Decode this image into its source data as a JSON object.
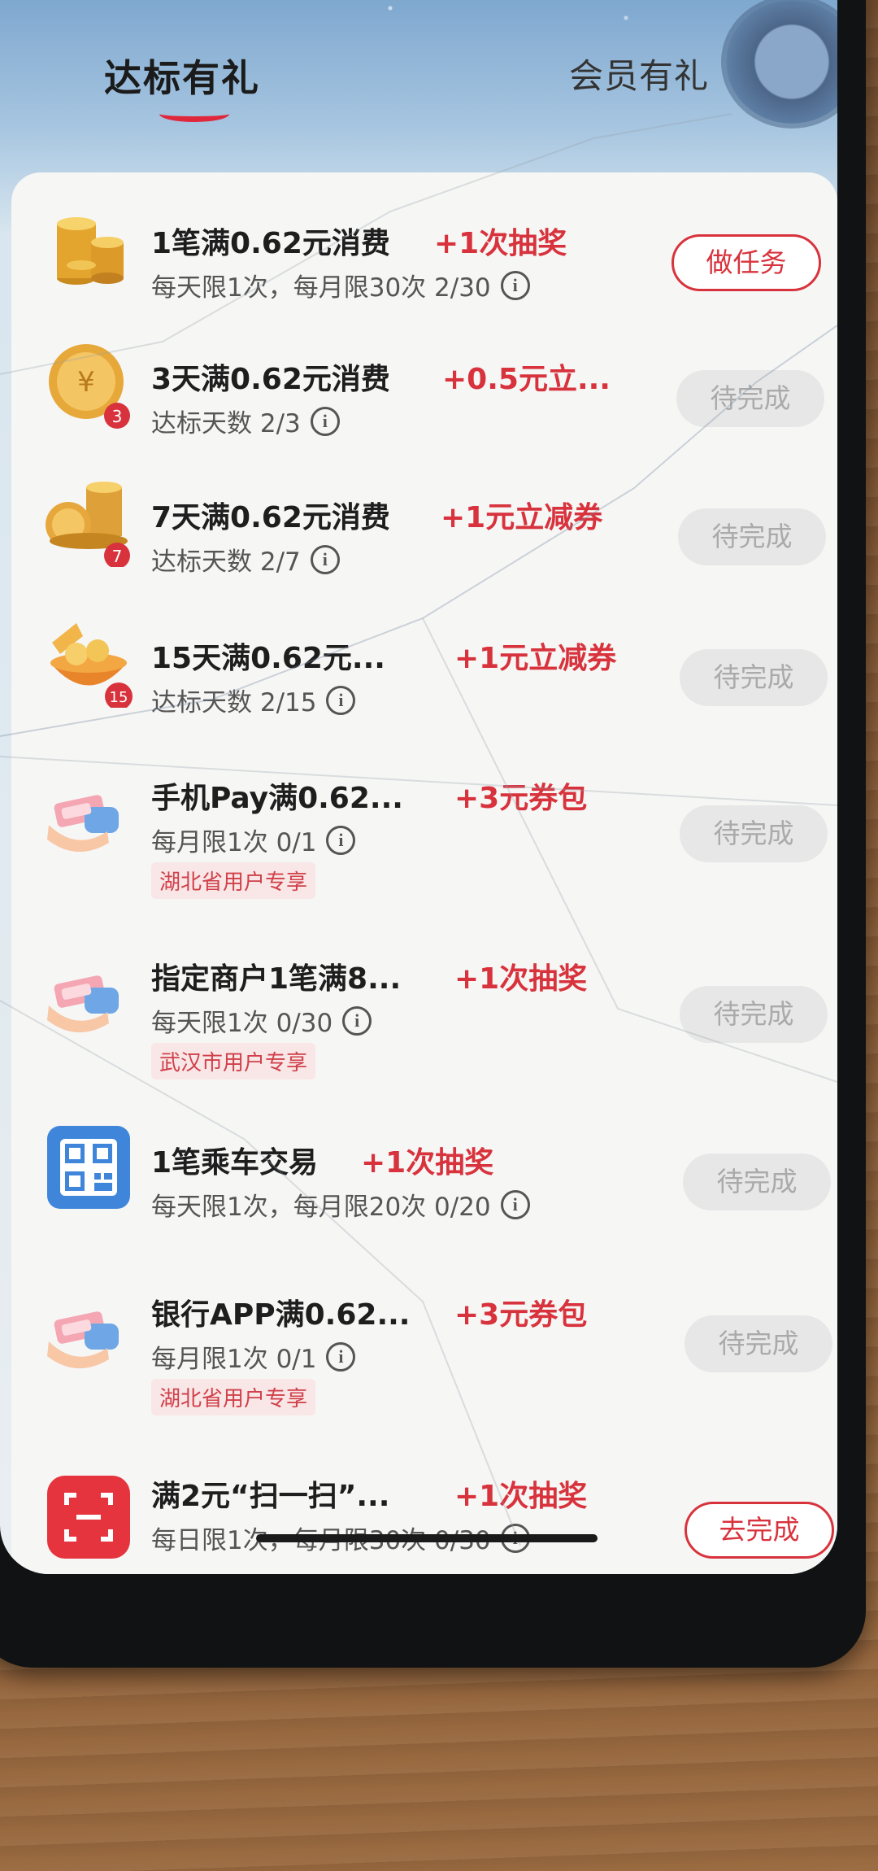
{
  "tabs": {
    "active": "达标有礼",
    "inactive": "会员有礼"
  },
  "tasks": [
    {
      "title": "1笔满0.62元消费",
      "reward": "+1次抽奖",
      "sub": "每天限1次，每月限30次  2/30",
      "button": "做任务",
      "button_state": "active",
      "icon": "coin-stack-icon"
    },
    {
      "title": "3天满0.62元消费",
      "reward": "+0.5元立...",
      "sub": "达标天数  2/3",
      "button": "待完成",
      "button_state": "pending",
      "icon": "coin-badge-3-icon",
      "badge": "3"
    },
    {
      "title": "7天满0.62元消费",
      "reward": "+1元立减券",
      "sub": "达标天数  2/7",
      "button": "待完成",
      "button_state": "pending",
      "icon": "coin-pile-badge-7-icon",
      "badge": "7"
    },
    {
      "title": "15天满0.62元...",
      "reward": "+1元立减券",
      "sub": "达标天数  2/15",
      "button": "待完成",
      "button_state": "pending",
      "icon": "treasure-bowl-badge-15-icon",
      "badge": "15"
    },
    {
      "title": "手机Pay满0.62...",
      "reward": "+3元券包",
      "sub": "每月限1次  0/1",
      "tag": "湖北省用户专享",
      "button": "待完成",
      "button_state": "pending",
      "icon": "hand-money-icon"
    },
    {
      "title": "指定商户1笔满8...",
      "reward": "+1次抽奖",
      "sub": "每天限1次  0/30",
      "tag": "武汉市用户专享",
      "button": "待完成",
      "button_state": "pending",
      "icon": "hand-money-icon"
    },
    {
      "title": "1笔乘车交易",
      "reward": "+1次抽奖",
      "sub": "每天限1次，每月限20次  0/20",
      "button": "待完成",
      "button_state": "pending",
      "icon": "qr-code-icon"
    },
    {
      "title": "银行APP满0.62...",
      "reward": "+3元券包",
      "sub": "每月限1次  0/1",
      "tag": "湖北省用户专享",
      "button": "待完成",
      "button_state": "pending",
      "icon": "hand-money-icon"
    },
    {
      "title": "满2元“扫一扫”...",
      "reward": "+1次抽奖",
      "sub": "每日限1次，每月限30次  0/30",
      "button": "去完成",
      "button_state": "active",
      "icon": "scan-icon"
    }
  ],
  "colors": {
    "accent": "#d8333d",
    "pending_bg": "#e7e7e7",
    "pending_text": "#aaaaaa"
  }
}
